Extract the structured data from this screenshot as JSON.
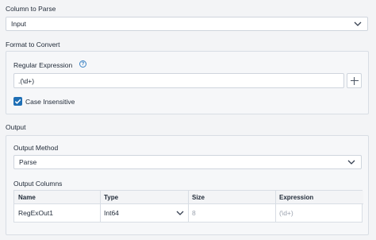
{
  "column_to_parse": {
    "label": "Column to Parse",
    "value": "Input"
  },
  "format_to_convert": {
    "label": "Format to Convert",
    "regex_label": "Regular Expression",
    "help_icon": "?",
    "regex_value": ".(\\d+)",
    "case_insensitive_label": "Case Insensitive",
    "case_insensitive_checked": true
  },
  "output": {
    "label": "Output",
    "method_label": "Output Method",
    "method_value": "Parse",
    "columns_label": "Output Columns",
    "columns_headers": [
      "Name",
      "Type",
      "Size",
      "Expression"
    ],
    "rows": [
      {
        "name": "RegExOut1",
        "type": "Int64",
        "size": "8",
        "expression": "(\\d+)"
      }
    ]
  },
  "colors": {
    "accent": "#1f6fb5"
  }
}
